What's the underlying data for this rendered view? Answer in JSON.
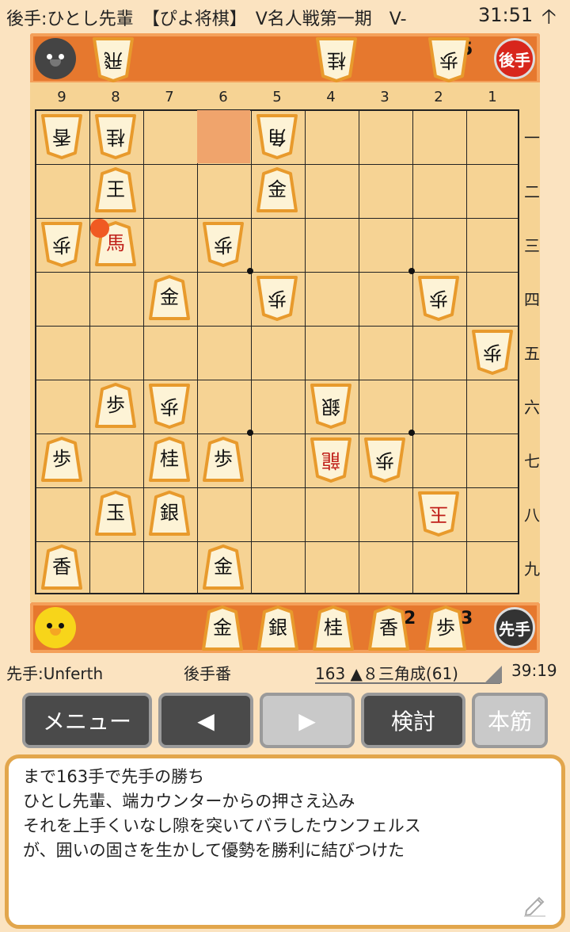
{
  "header": {
    "title": "後手:ひとし先輩　【ぴよ将棋】　V名人戦第一期　V-",
    "clock": "31:51",
    "up_icon": "arrow-up-icon"
  },
  "gote_stand": {
    "badge": "後手",
    "pieces": [
      {
        "label": "飛",
        "count": ""
      },
      {
        "label": "桂",
        "count": ""
      },
      {
        "label": "歩",
        "count": "5"
      }
    ]
  },
  "sente_stand": {
    "badge": "先手",
    "pieces": [
      {
        "label": "金",
        "count": ""
      },
      {
        "label": "銀",
        "count": ""
      },
      {
        "label": "桂",
        "count": ""
      },
      {
        "label": "香",
        "count": "2"
      },
      {
        "label": "歩",
        "count": "3"
      }
    ]
  },
  "board": {
    "files": [
      "9",
      "8",
      "7",
      "6",
      "5",
      "4",
      "3",
      "2",
      "1"
    ],
    "ranks": [
      "一",
      "二",
      "三",
      "四",
      "五",
      "六",
      "七",
      "八",
      "九"
    ],
    "highlight": {
      "file": 6,
      "rank": 1
    },
    "last_move_marker": {
      "file": 8,
      "rank": 3
    },
    "pieces": [
      {
        "file": 9,
        "rank": 1,
        "label": "香",
        "owner": "gote",
        "promoted": false
      },
      {
        "file": 8,
        "rank": 1,
        "label": "桂",
        "owner": "gote",
        "promoted": false
      },
      {
        "file": 5,
        "rank": 1,
        "label": "角",
        "owner": "gote",
        "promoted": false
      },
      {
        "file": 8,
        "rank": 2,
        "label": "王",
        "owner": "gote",
        "promoted": false,
        "upright": true
      },
      {
        "file": 5,
        "rank": 2,
        "label": "金",
        "owner": "gote",
        "promoted": false,
        "upright": true
      },
      {
        "file": 9,
        "rank": 3,
        "label": "歩",
        "owner": "gote",
        "promoted": false
      },
      {
        "file": 8,
        "rank": 3,
        "label": "馬",
        "owner": "sente",
        "promoted": true
      },
      {
        "file": 6,
        "rank": 3,
        "label": "歩",
        "owner": "gote",
        "promoted": false
      },
      {
        "file": 7,
        "rank": 4,
        "label": "金",
        "owner": "sente",
        "promoted": false
      },
      {
        "file": 5,
        "rank": 4,
        "label": "歩",
        "owner": "gote",
        "promoted": false
      },
      {
        "file": 2,
        "rank": 4,
        "label": "歩",
        "owner": "gote",
        "promoted": false
      },
      {
        "file": 1,
        "rank": 5,
        "label": "歩",
        "owner": "gote",
        "promoted": false
      },
      {
        "file": 8,
        "rank": 6,
        "label": "歩",
        "owner": "sente",
        "promoted": false
      },
      {
        "file": 7,
        "rank": 6,
        "label": "歩",
        "owner": "gote",
        "promoted": false
      },
      {
        "file": 4,
        "rank": 6,
        "label": "銀",
        "owner": "gote",
        "promoted": false
      },
      {
        "file": 9,
        "rank": 7,
        "label": "歩",
        "owner": "sente",
        "promoted": false
      },
      {
        "file": 7,
        "rank": 7,
        "label": "桂",
        "owner": "sente",
        "promoted": false
      },
      {
        "file": 6,
        "rank": 7,
        "label": "歩",
        "owner": "sente",
        "promoted": false
      },
      {
        "file": 4,
        "rank": 7,
        "label": "龍",
        "owner": "gote",
        "promoted": true
      },
      {
        "file": 3,
        "rank": 7,
        "label": "歩",
        "owner": "gote",
        "promoted": false
      },
      {
        "file": 8,
        "rank": 8,
        "label": "玉",
        "owner": "sente",
        "promoted": false
      },
      {
        "file": 7,
        "rank": 8,
        "label": "銀",
        "owner": "sente",
        "promoted": false
      },
      {
        "file": 2,
        "rank": 8,
        "label": "玉",
        "owner": "gote",
        "promoted": true
      },
      {
        "file": 9,
        "rank": 9,
        "label": "香",
        "owner": "sente",
        "promoted": false
      },
      {
        "file": 6,
        "rank": 9,
        "label": "金",
        "owner": "sente",
        "promoted": false
      }
    ]
  },
  "status": {
    "sente_player": "先手:Unferth",
    "turn": "後手番",
    "move": "163 ▲８三角成(61)",
    "time": "39:19"
  },
  "buttons": {
    "menu": "メニュー",
    "prev": "◀",
    "next": "▶",
    "analyze": "検討",
    "mainline": "本筋"
  },
  "comment": {
    "lines": [
      "まで163手で先手の勝ち",
      "ひとし先輩、端カウンターからの押さえ込み",
      "それを上手くいなし隙を突いてバラしたウンフェルス",
      "が、囲いの固さを生かして優勢を勝利に結びつけた"
    ],
    "edit_icon": "pencil-icon"
  },
  "colors": {
    "stand": "#e6782e",
    "board": "#f6d394",
    "highlight": "#f0a46c",
    "promoted_text": "#c0201a",
    "button_dark": "#4a4a4a",
    "comment_border": "#e2a64c"
  }
}
